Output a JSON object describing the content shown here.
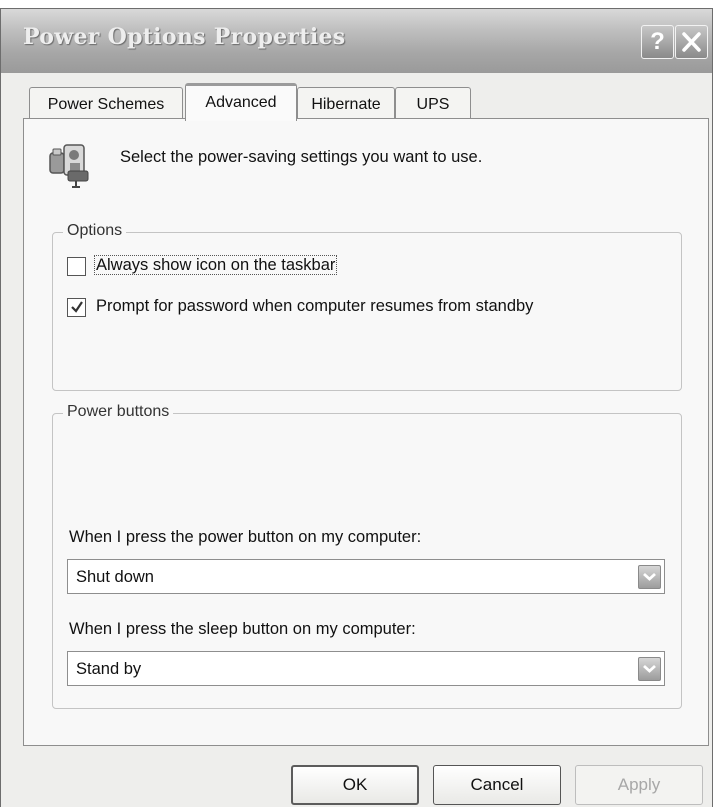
{
  "window": {
    "title": "Power Options Properties"
  },
  "tabs": [
    {
      "label": "Power Schemes",
      "active": false
    },
    {
      "label": "Advanced",
      "active": true
    },
    {
      "label": "Hibernate",
      "active": false
    },
    {
      "label": "UPS",
      "active": false
    }
  ],
  "intro": {
    "text": "Select the power-saving settings you want to use.",
    "icon": "power-settings-icon"
  },
  "options": {
    "legend": "Options",
    "always_show_icon": {
      "label": "Always show icon on the taskbar",
      "checked": false
    },
    "prompt_password": {
      "label": "Prompt for password when computer resumes from standby",
      "checked": true
    }
  },
  "power_buttons": {
    "legend": "Power buttons",
    "power_button": {
      "label": "When I press the power button on my computer:",
      "value": "Shut down"
    },
    "sleep_button": {
      "label": "When I press the sleep button on my computer:",
      "value": "Stand by"
    }
  },
  "buttons": {
    "ok": "OK",
    "cancel": "Cancel",
    "apply": "Apply"
  }
}
